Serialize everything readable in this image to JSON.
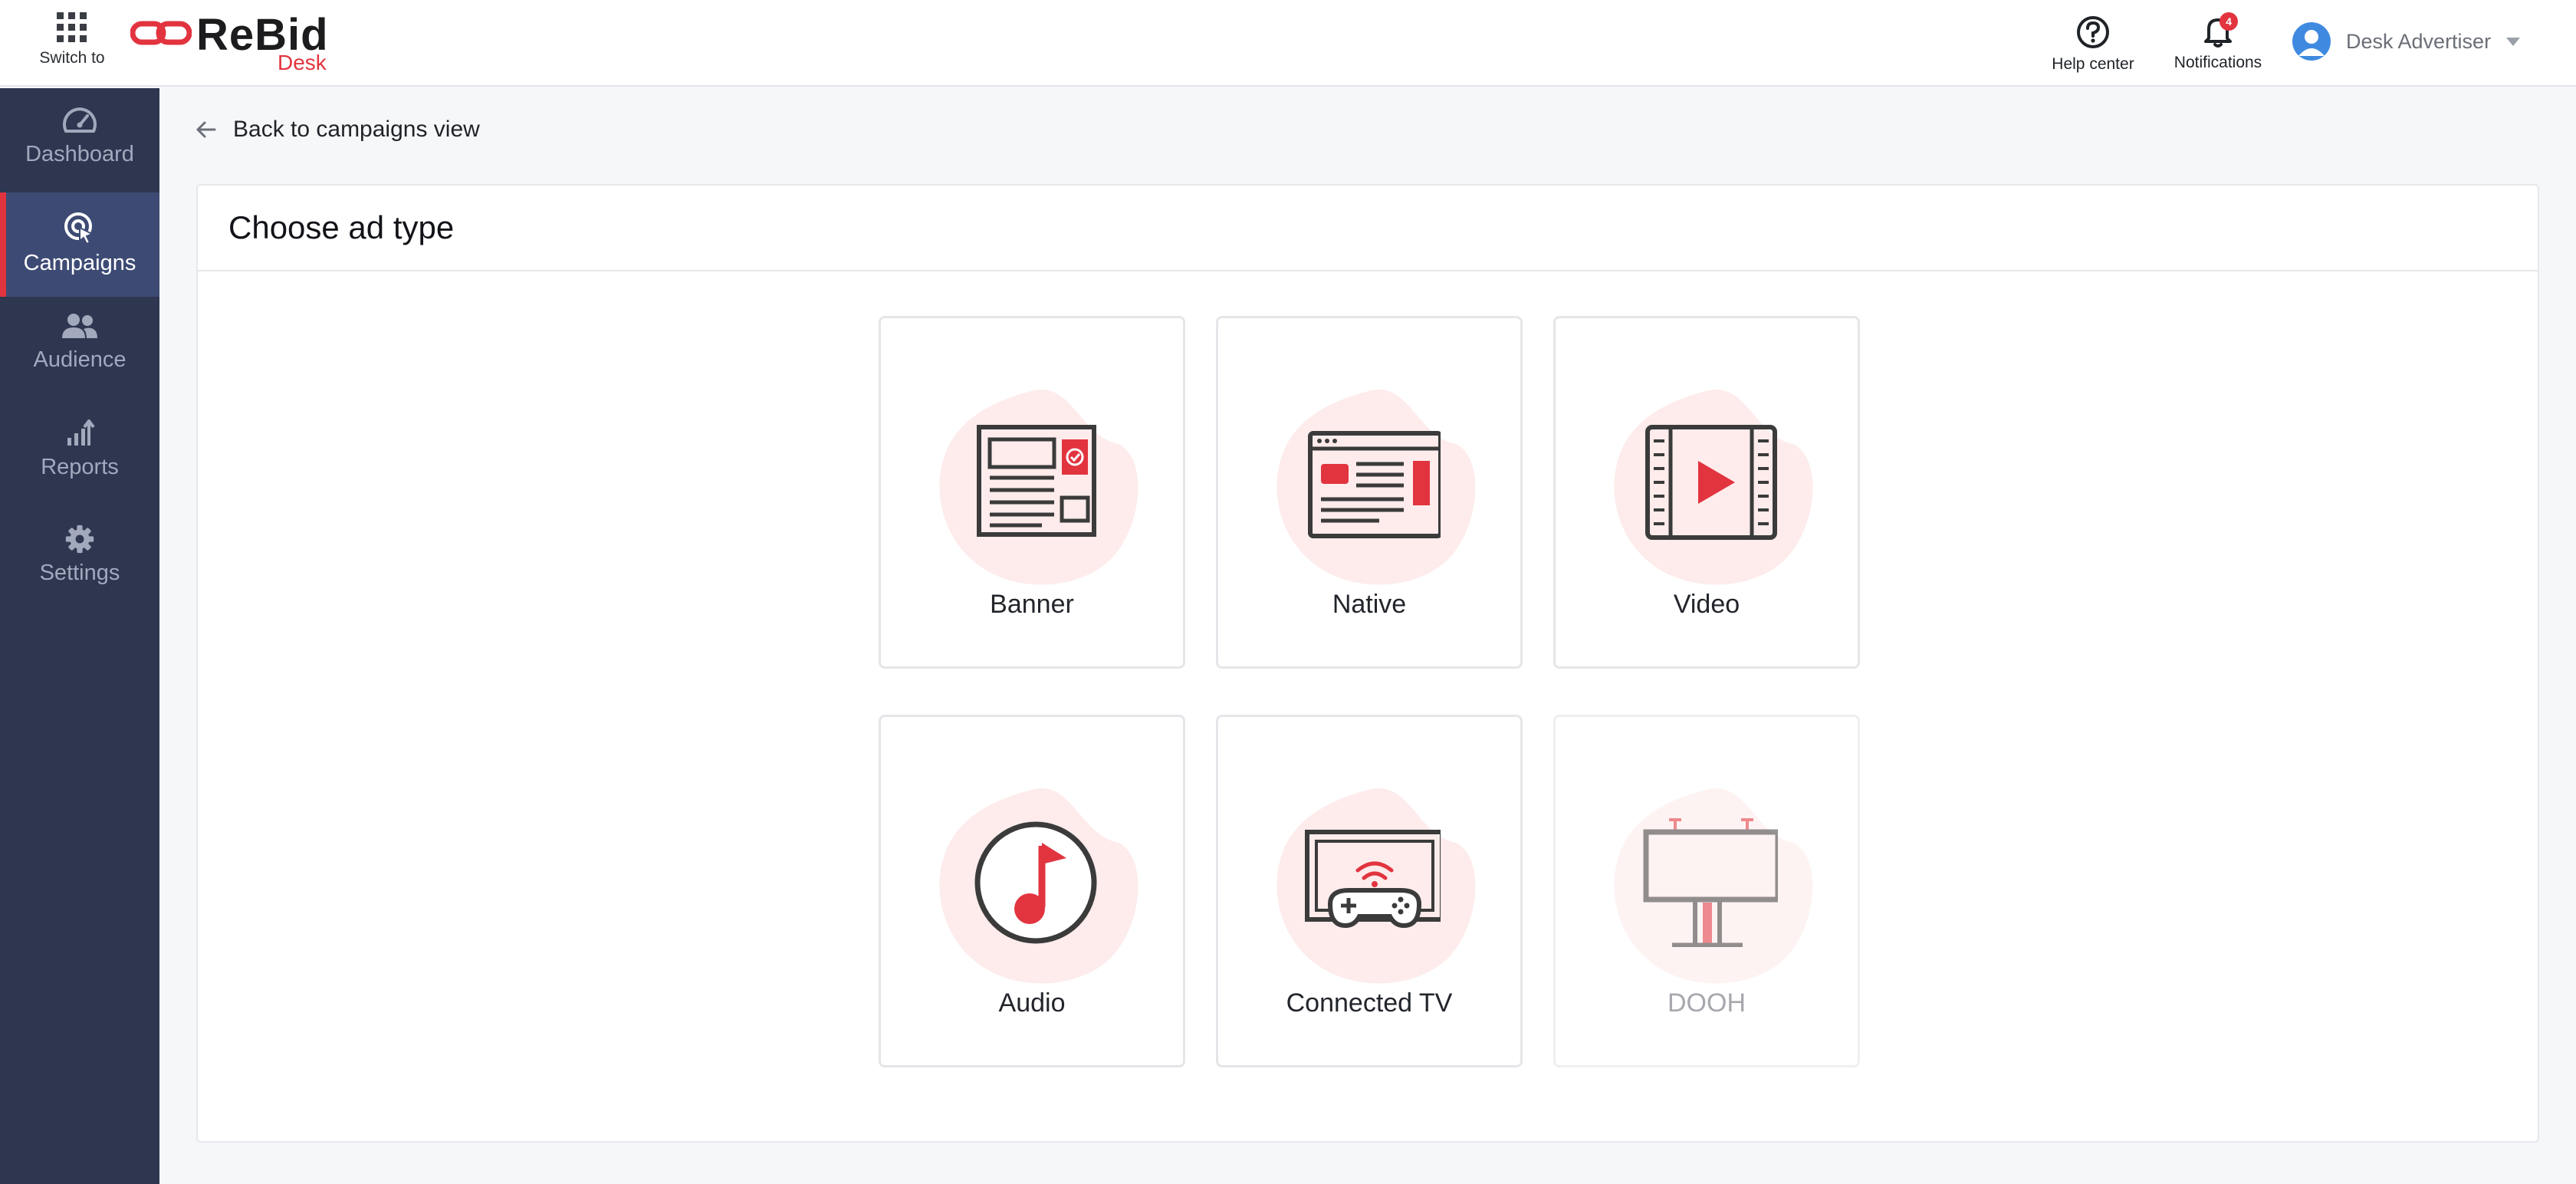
{
  "header": {
    "switch_label": "Switch to",
    "logo_text": "ReBid",
    "logo_sub": "Desk",
    "help_label": "Help center",
    "notifications_label": "Notifications",
    "notifications_count": "4",
    "user_name": "Desk Advertiser"
  },
  "sidebar": {
    "items": [
      {
        "label": "Dashboard",
        "icon": "dashboard-icon"
      },
      {
        "label": "Campaigns",
        "icon": "campaigns-icon",
        "active": true
      },
      {
        "label": "Audience",
        "icon": "audience-icon"
      },
      {
        "label": "Reports",
        "icon": "reports-icon"
      },
      {
        "label": "Settings",
        "icon": "settings-icon"
      }
    ]
  },
  "main": {
    "back_label": "Back to campaigns view",
    "title": "Choose ad type",
    "ad_types": [
      {
        "label": "Banner",
        "icon": "banner-icon",
        "enabled": true
      },
      {
        "label": "Native",
        "icon": "native-icon",
        "enabled": true
      },
      {
        "label": "Video",
        "icon": "video-icon",
        "enabled": true
      },
      {
        "label": "Audio",
        "icon": "audio-icon",
        "enabled": true
      },
      {
        "label": "Connected TV",
        "icon": "connected-tv-icon",
        "enabled": true
      },
      {
        "label": "DOOH",
        "icon": "dooh-icon",
        "enabled": false
      }
    ]
  },
  "colors": {
    "accent": "#e2343f",
    "sidebar_bg": "#2f3650",
    "sidebar_active_bg": "#3d4b74",
    "blob": "#fdeceb",
    "icon_stroke": "#3b3b3b"
  }
}
